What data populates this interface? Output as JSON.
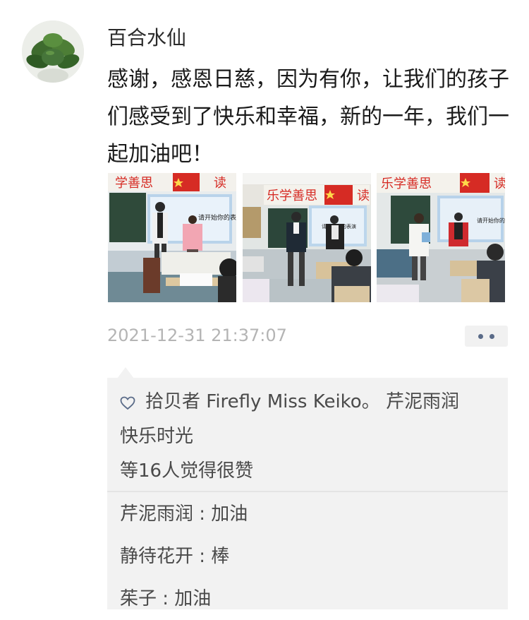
{
  "post": {
    "author": "百合水仙",
    "text": "感谢，感恩日慈，因为有你，让我们的孩子们感受到了快乐和幸福，新的一年，我们一起加油吧！",
    "photos": [
      {
        "banner_text": "学善思",
        "banner_right": "读",
        "screen_text": "请开始你的表演"
      },
      {
        "banner_text": "乐学善思",
        "banner_right": "读",
        "screen_text": "请开始你的表演"
      },
      {
        "banner_text": "乐学善思",
        "banner_right": "读",
        "screen_text": "请开始你的表演"
      }
    ],
    "timestamp": "2021-12-31 21:37:07"
  },
  "likes": {
    "icon": "heart-outline-icon",
    "names_line1": "拾贝者 Firefly Miss Keiko。 芹泥雨润",
    "names_line2": "快乐时光",
    "summary": "等16人觉得很赞"
  },
  "comments": [
    {
      "text": "芹泥雨润 : 加油"
    },
    {
      "text": "静待花开 : 棒"
    },
    {
      "text": "茱子 : 加油"
    }
  ],
  "colors": {
    "link_blue": "#5a6b88",
    "panel_gray": "#f2f2f2",
    "timestamp_gray": "#b4b4b4"
  }
}
